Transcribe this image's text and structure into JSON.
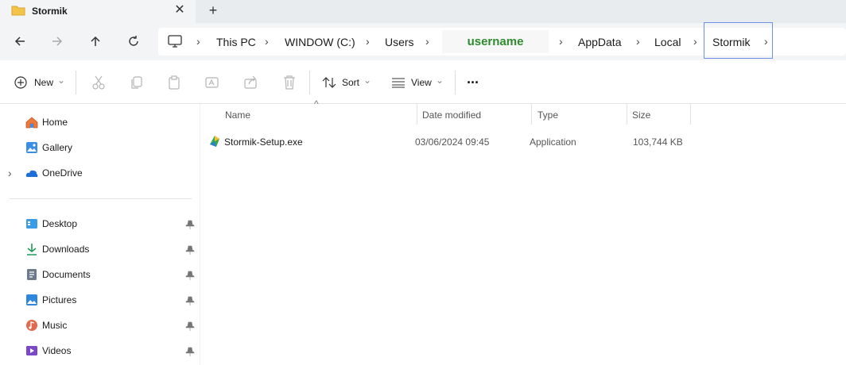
{
  "tab": {
    "title": "Stormik",
    "close_glyph": "✕",
    "new_tab_glyph": "+"
  },
  "nav": {
    "breadcrumb": [
      "This PC",
      "WINDOW (C:)",
      "Users",
      "username",
      "AppData",
      "Local",
      "Stormik"
    ],
    "separator": "›"
  },
  "toolbar": {
    "new_label": "New",
    "sort_label": "Sort",
    "view_label": "View",
    "more_glyph": "···",
    "chevron_glyph": "⌄"
  },
  "sidebar": {
    "top_items": [
      {
        "label": "Home",
        "icon": "home-icon"
      },
      {
        "label": "Gallery",
        "icon": "gallery-icon"
      },
      {
        "label": "OneDrive",
        "icon": "onedrive-icon"
      }
    ],
    "quick_access": [
      {
        "label": "Desktop",
        "icon": "desktop-folder-icon"
      },
      {
        "label": "Downloads",
        "icon": "downloads-icon"
      },
      {
        "label": "Documents",
        "icon": "documents-icon"
      },
      {
        "label": "Pictures",
        "icon": "pictures-icon"
      },
      {
        "label": "Music",
        "icon": "music-icon"
      },
      {
        "label": "Videos",
        "icon": "videos-icon"
      }
    ],
    "expand_glyph": "›"
  },
  "columns": {
    "name": "Name",
    "date": "Date modified",
    "type": "Type",
    "size": "Size",
    "sort_glyph": "^"
  },
  "files": [
    {
      "name": "Stormik-Setup.exe",
      "date": "03/06/2024 09:45",
      "type": "Application",
      "size": "103,744 KB"
    }
  ],
  "colors": {
    "accent": "#0067c0",
    "username": "#2e8b2e",
    "highlight_border": "#6f8fe6",
    "folder": "#f4c44a"
  }
}
